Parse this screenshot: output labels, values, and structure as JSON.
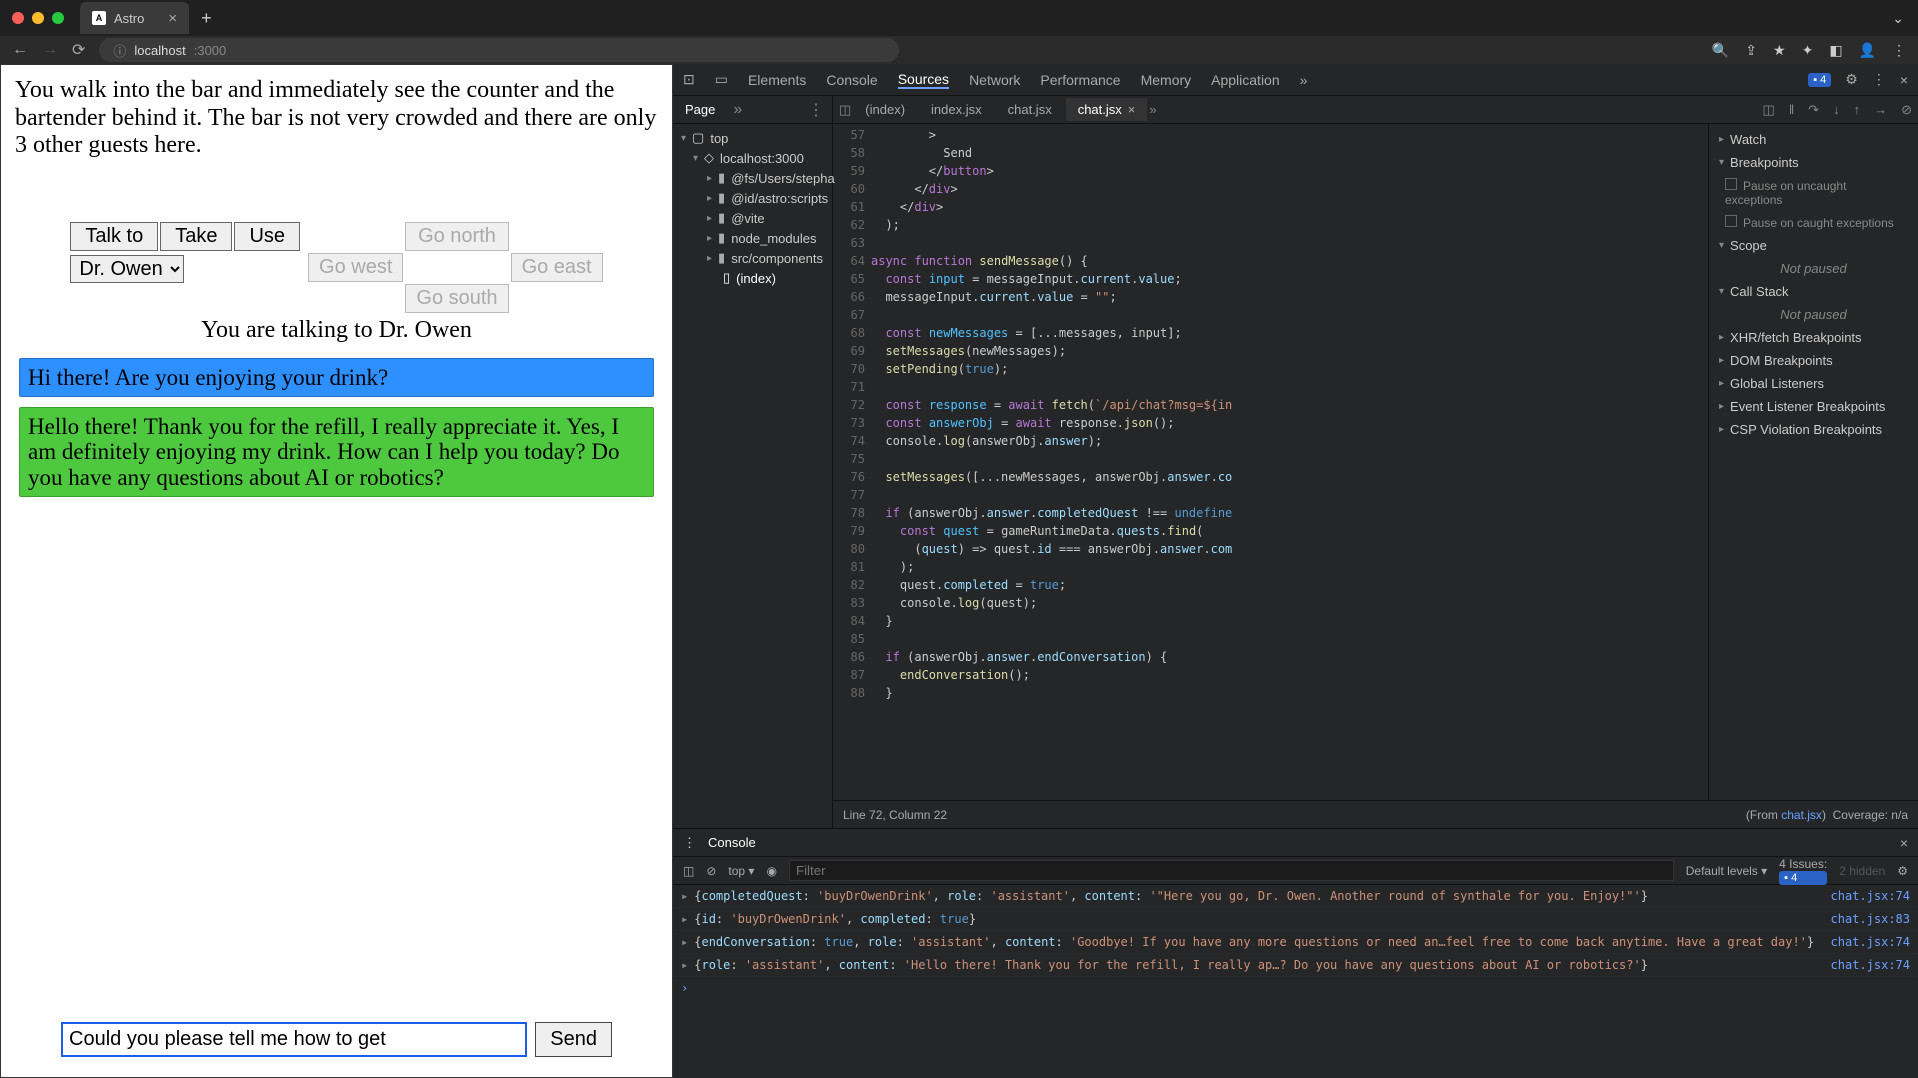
{
  "browser": {
    "tab_title": "Astro",
    "url_host": "localhost",
    "url_path": ":3000"
  },
  "page": {
    "narrative": "You walk into the bar and immediately see the counter and the bartender behind it. The bar is not very crowded and there are only 3 other guests here.",
    "actions": {
      "talk_to": "Talk to",
      "take": "Take",
      "use": "Use",
      "selected_person": "Dr. Owen",
      "go_north": "Go north",
      "go_west": "Go west",
      "go_east": "Go east",
      "go_south": "Go south"
    },
    "talking_to": "You are talking to Dr. Owen",
    "messages": {
      "user": "Hi there! Are you enjoying your drink?",
      "assistant": "Hello there! Thank you for the refill, I really appreciate it. Yes, I am definitely enjoying my drink. How can I help you today? Do you have any questions about AI or robotics?"
    },
    "input_value": "Could you please tell me how to get ",
    "send_label": "Send"
  },
  "devtools": {
    "tabs": {
      "elements": "Elements",
      "console": "Console",
      "sources": "Sources",
      "network": "Network",
      "performance": "Performance",
      "memory": "Memory",
      "application": "Application"
    },
    "issue_count": "4",
    "page_label": "Page",
    "file_tree": {
      "top": "top",
      "host": "localhost:3000",
      "fs": "@fs/Users/stepha",
      "astro": "@id/astro:scripts",
      "vite": "@vite",
      "node_modules": "node_modules",
      "src_components": "src/components",
      "index": "(index)"
    },
    "editor_tabs": {
      "index": "(index)",
      "index_jsx": "index.jsx",
      "chat_jsx_1": "chat.jsx",
      "chat_jsx_2": "chat.jsx"
    },
    "gutter_lines": [
      "57",
      "58",
      "59",
      "60",
      "61",
      "62",
      "63",
      "64",
      "65",
      "66",
      "67",
      "68",
      "69",
      "70",
      "71",
      "72",
      "73",
      "74",
      "75",
      "76",
      "77",
      "78",
      "79",
      "80",
      "81",
      "82",
      "83",
      "84",
      "85",
      "86",
      "87",
      "88"
    ],
    "status": {
      "cursor": "Line 72, Column 22",
      "from_label": "(From ",
      "from_file": "chat.jsx",
      "from_close": ")",
      "coverage": "Coverage: n/a"
    },
    "right_panel": {
      "watch": "Watch",
      "breakpoints": "Breakpoints",
      "pause_uncaught": "Pause on uncaught exceptions",
      "pause_caught": "Pause on caught exceptions",
      "scope": "Scope",
      "not_paused": "Not paused",
      "call_stack": "Call Stack",
      "xhr": "XHR/fetch Breakpoints",
      "dom": "DOM Breakpoints",
      "global": "Global Listeners",
      "event": "Event Listener Breakpoints",
      "csp": "CSP Violation Breakpoints"
    }
  },
  "console": {
    "header_title": "Console",
    "context": "top",
    "filter_placeholder": "Filter",
    "levels": "Default levels",
    "issues_label": "4 Issues:",
    "issues_count": "4",
    "hidden": "2 hidden",
    "lines": [
      {
        "src": "chat.jsx:74",
        "text": "{completedQuest: 'buyDrOwenDrink', role: 'assistant', content: '\"Here you go, Dr. Owen. Another round of synthale for you. Enjoy!\"'}"
      },
      {
        "src": "chat.jsx:83",
        "text": "{id: 'buyDrOwenDrink', completed: true}"
      },
      {
        "src": "chat.jsx:74",
        "text": "{endConversation: true, role: 'assistant', content: 'Goodbye! If you have any more questions or need an…feel free to come back anytime. Have a great day!'}"
      },
      {
        "src": "chat.jsx:74",
        "text": "{role: 'assistant', content: 'Hello there! Thank you for the refill, I really ap…? Do you have any questions about AI or robotics?'}"
      }
    ]
  }
}
